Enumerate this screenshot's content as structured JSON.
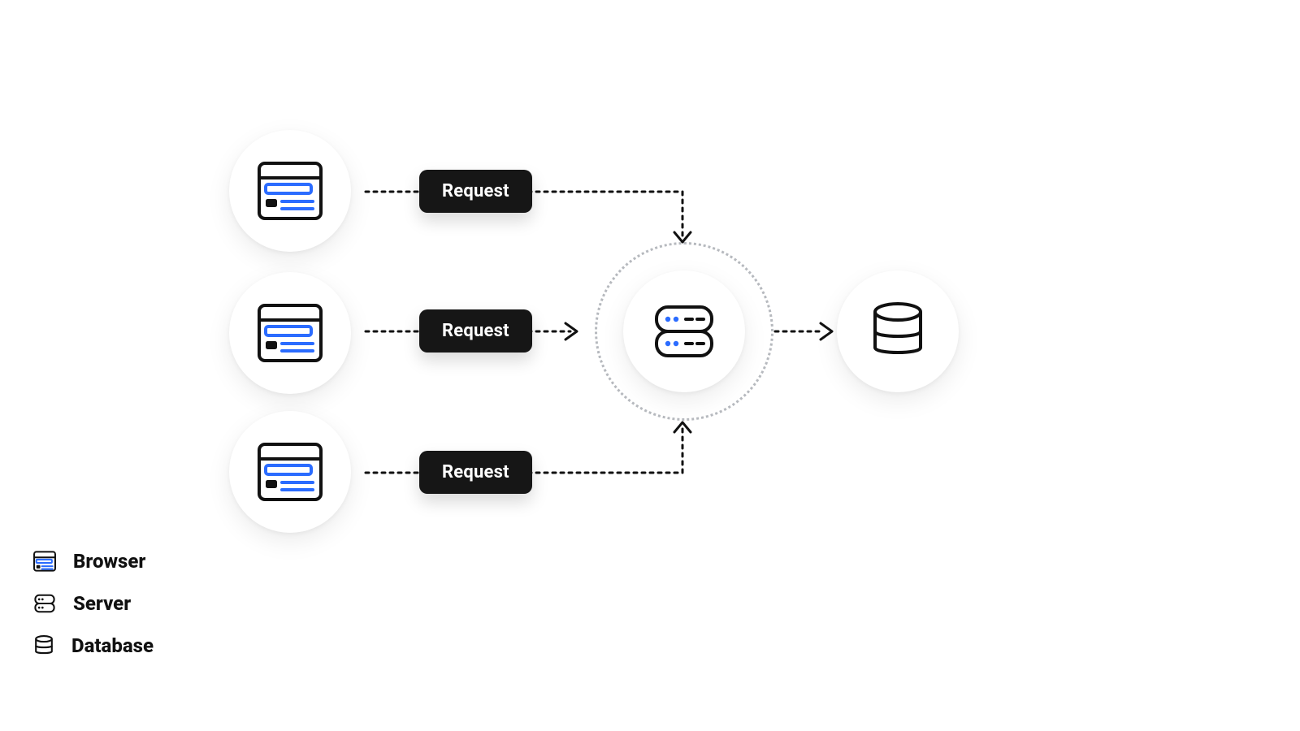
{
  "flow": {
    "requests": [
      {
        "label": "Request"
      },
      {
        "label": "Request"
      },
      {
        "label": "Request"
      }
    ]
  },
  "legend": {
    "browser": "Browser",
    "server": "Server",
    "database": "Database"
  }
}
